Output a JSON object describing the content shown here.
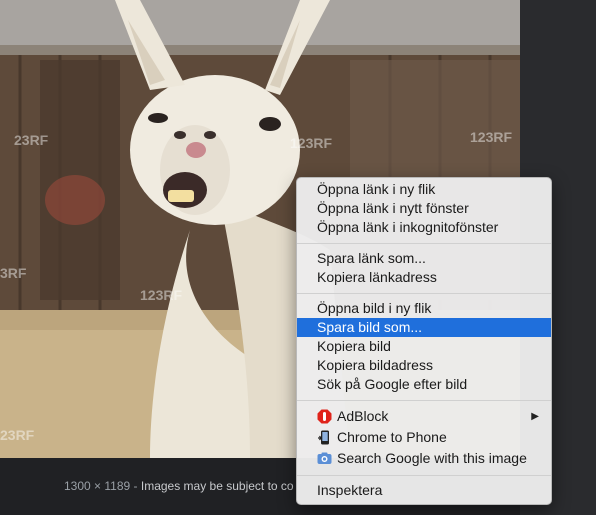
{
  "image_info": {
    "dimensions": "1300 × 1189",
    "separator": " - ",
    "notice": "Images may be subject to co"
  },
  "context_menu": {
    "groups": [
      [
        "Öppna länk i ny flik",
        "Öppna länk i nytt fönster",
        "Öppna länk i inkognitofönster"
      ],
      [
        "Spara länk som...",
        "Kopiera länkadress"
      ],
      [
        "Öppna bild i ny flik",
        "Spara bild som...",
        "Kopiera bild",
        "Kopiera bildadress",
        "Sök på Google efter bild"
      ]
    ],
    "highlighted": "Spara bild som...",
    "extensions": [
      {
        "label": "AdBlock",
        "icon": "adblock-icon",
        "submenu": true
      },
      {
        "label": "Chrome to Phone",
        "icon": "phone-icon",
        "submenu": false
      },
      {
        "label": "Search Google with this image",
        "icon": "camera-icon",
        "submenu": false
      }
    ],
    "inspect": "Inspektera"
  },
  "watermark": "123RF",
  "colors": {
    "highlight": "#1f6fdc",
    "adblock": "#e0231a"
  }
}
